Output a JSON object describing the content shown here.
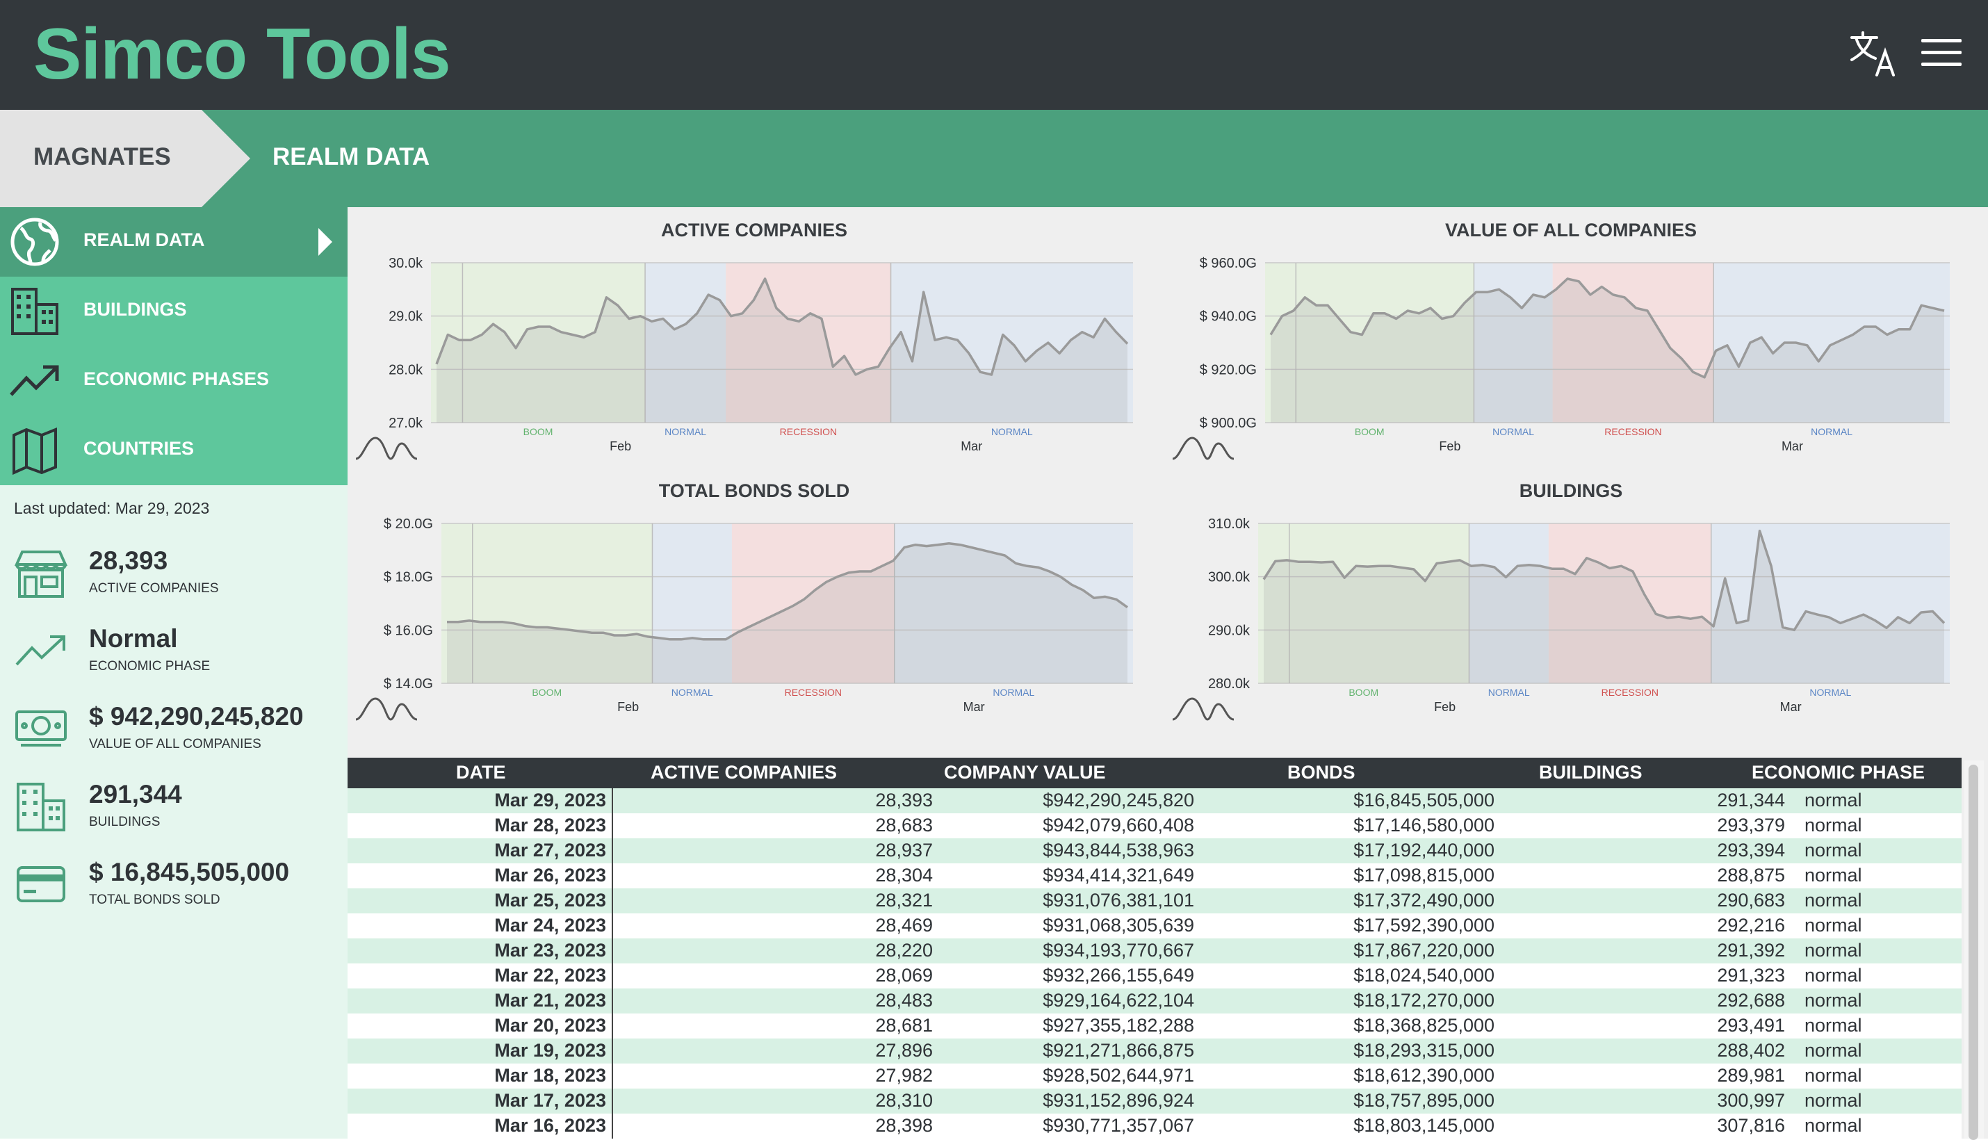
{
  "app": {
    "title": "Simco Tools"
  },
  "breadcrumb": {
    "items": [
      "MAGNATES",
      "REALM DATA"
    ]
  },
  "sidebar": {
    "items": [
      {
        "label": "REALM DATA",
        "icon": "globe-icon"
      },
      {
        "label": "BUILDINGS",
        "icon": "buildings-icon"
      },
      {
        "label": "ECONOMIC PHASES",
        "icon": "trending-up-icon"
      },
      {
        "label": "COUNTRIES",
        "icon": "map-icon"
      }
    ],
    "last_updated": "Last updated: Mar 29, 2023",
    "stats": [
      {
        "value": "28,393",
        "label": "ACTIVE COMPANIES",
        "icon": "store-icon"
      },
      {
        "value": "Normal",
        "label": "ECONOMIC PHASE",
        "icon": "trending-up-icon"
      },
      {
        "value": "$ 942,290,245,820",
        "label": "VALUE OF ALL COMPANIES",
        "icon": "money-icon"
      },
      {
        "value": "291,344",
        "label": "BUILDINGS",
        "icon": "buildings-icon"
      },
      {
        "value": "$ 16,845,505,000",
        "label": "TOTAL BONDS SOLD",
        "icon": "credit-card-icon"
      }
    ]
  },
  "colors": {
    "header": "#33383c",
    "accent": "#5ec79c",
    "accent_dark": "#4ba07d",
    "boom": "#e6f0e0",
    "normal": "#e1e8f1",
    "recession": "#f4dfdf"
  },
  "phase_labels": {
    "boom": "BOOM",
    "normal": "NORMAL",
    "recession": "RECESSION"
  },
  "chart_data": [
    {
      "type": "line",
      "title": "ACTIVE COMPANIES",
      "yticks": [
        "30.0k",
        "29.0k",
        "28.0k",
        "27.0k"
      ],
      "ylim": [
        27000,
        30000
      ],
      "xticks": [
        "Feb",
        "Mar"
      ],
      "phases": [
        "boom",
        "normal",
        "recession",
        "normal"
      ],
      "values": [
        28100,
        28650,
        28550,
        28550,
        28650,
        28850,
        28700,
        28400,
        28750,
        28800,
        28800,
        28700,
        28650,
        28600,
        28700,
        29350,
        29200,
        28950,
        29000,
        28900,
        28950,
        28750,
        28850,
        29050,
        29400,
        29300,
        29000,
        29050,
        29300,
        29700,
        29150,
        28950,
        28900,
        29050,
        28950,
        28050,
        28250,
        27900,
        28000,
        28050,
        28400,
        28700,
        28150,
        29450,
        28550,
        28600,
        28550,
        28300,
        27950,
        27900,
        28650,
        28450,
        28150,
        28350,
        28500,
        28300,
        28550,
        28700,
        28600,
        28950,
        28700,
        28480
      ]
    },
    {
      "type": "line",
      "title": "VALUE OF ALL COMPANIES",
      "yticks": [
        "$ 960.0G",
        "$ 940.0G",
        "$ 920.0G",
        "$ 900.0G"
      ],
      "ylim": [
        900,
        960
      ],
      "xticks": [
        "Feb",
        "Mar"
      ],
      "phases": [
        "boom",
        "normal",
        "recession",
        "normal"
      ],
      "values": [
        933,
        940,
        942,
        947,
        944,
        944,
        939,
        934,
        933,
        941,
        941,
        939,
        942,
        941,
        943,
        939,
        940,
        945,
        949,
        949,
        950,
        947,
        943,
        948,
        947,
        950,
        954,
        953,
        948,
        951,
        948,
        947,
        943,
        942,
        935,
        928,
        924,
        919,
        917,
        927,
        929,
        921,
        930,
        932,
        926,
        930,
        930,
        929,
        923,
        929,
        931,
        933,
        936,
        936,
        933,
        935,
        935,
        944,
        943,
        942
      ]
    },
    {
      "type": "area",
      "title": "TOTAL BONDS SOLD",
      "yticks": [
        "$ 20.0G",
        "$ 18.0G",
        "$ 16.0G",
        "$ 14.0G"
      ],
      "ylim": [
        14,
        20
      ],
      "xticks": [
        "Feb",
        "Mar"
      ],
      "phases": [
        "boom",
        "normal",
        "recession",
        "normal"
      ],
      "values": [
        16.3,
        16.3,
        16.35,
        16.3,
        16.3,
        16.3,
        16.25,
        16.15,
        16.1,
        16.1,
        16.05,
        16.0,
        15.95,
        15.9,
        15.9,
        15.8,
        15.8,
        15.85,
        15.75,
        15.7,
        15.65,
        15.65,
        15.7,
        15.65,
        15.65,
        15.65,
        15.9,
        16.1,
        16.3,
        16.5,
        16.7,
        16.9,
        17.15,
        17.5,
        17.8,
        18.0,
        18.15,
        18.2,
        18.2,
        18.4,
        18.6,
        19.1,
        19.2,
        19.15,
        19.2,
        19.25,
        19.2,
        19.1,
        19.0,
        18.9,
        18.8,
        18.5,
        18.4,
        18.35,
        18.2,
        18.0,
        17.7,
        17.5,
        17.2,
        17.25,
        17.15,
        16.85
      ]
    },
    {
      "type": "line",
      "title": "BUILDINGS",
      "yticks": [
        "310.0k",
        "300.0k",
        "290.0k",
        "280.0k"
      ],
      "ylim": [
        280000,
        310000
      ],
      "xticks": [
        "Feb",
        "Mar"
      ],
      "phases": [
        "boom",
        "normal",
        "recession",
        "normal"
      ],
      "values": [
        299500,
        302900,
        303100,
        302800,
        302800,
        302700,
        302800,
        299800,
        302000,
        301900,
        302000,
        302000,
        301700,
        301400,
        299200,
        302500,
        302800,
        303100,
        302000,
        302200,
        301800,
        299900,
        302000,
        302200,
        302000,
        301500,
        301500,
        300500,
        303500,
        302700,
        301600,
        302000,
        301000,
        296700,
        293000,
        292300,
        292500,
        292100,
        292500,
        290700,
        299700,
        291300,
        291800,
        308600,
        302000,
        290500,
        290000,
        293500,
        292900,
        292400,
        291300,
        292100,
        292900,
        291800,
        290400,
        292400,
        291300,
        293300,
        293500,
        291300
      ]
    }
  ],
  "table": {
    "headers": [
      "DATE",
      "ACTIVE COMPANIES",
      "COMPANY VALUE",
      "BONDS",
      "BUILDINGS",
      "ECONOMIC PHASE"
    ],
    "rows": [
      [
        "Mar 29, 2023",
        "28,393",
        "$942,290,245,820",
        "$16,845,505,000",
        "291,344",
        "normal"
      ],
      [
        "Mar 28, 2023",
        "28,683",
        "$942,079,660,408",
        "$17,146,580,000",
        "293,379",
        "normal"
      ],
      [
        "Mar 27, 2023",
        "28,937",
        "$943,844,538,963",
        "$17,192,440,000",
        "293,394",
        "normal"
      ],
      [
        "Mar 26, 2023",
        "28,304",
        "$934,414,321,649",
        "$17,098,815,000",
        "288,875",
        "normal"
      ],
      [
        "Mar 25, 2023",
        "28,321",
        "$931,076,381,101",
        "$17,372,490,000",
        "290,683",
        "normal"
      ],
      [
        "Mar 24, 2023",
        "28,469",
        "$931,068,305,639",
        "$17,592,390,000",
        "292,216",
        "normal"
      ],
      [
        "Mar 23, 2023",
        "28,220",
        "$934,193,770,667",
        "$17,867,220,000",
        "291,392",
        "normal"
      ],
      [
        "Mar 22, 2023",
        "28,069",
        "$932,266,155,649",
        "$18,024,540,000",
        "291,323",
        "normal"
      ],
      [
        "Mar 21, 2023",
        "28,483",
        "$929,164,622,104",
        "$18,172,270,000",
        "292,688",
        "normal"
      ],
      [
        "Mar 20, 2023",
        "28,681",
        "$927,355,182,288",
        "$18,368,825,000",
        "293,491",
        "normal"
      ],
      [
        "Mar 19, 2023",
        "27,896",
        "$921,271,866,875",
        "$18,293,315,000",
        "288,402",
        "normal"
      ],
      [
        "Mar 18, 2023",
        "27,982",
        "$928,502,644,971",
        "$18,612,390,000",
        "289,981",
        "normal"
      ],
      [
        "Mar 17, 2023",
        "28,310",
        "$931,152,896,924",
        "$18,757,895,000",
        "300,997",
        "normal"
      ],
      [
        "Mar 16, 2023",
        "28,398",
        "$930,771,357,067",
        "$18,803,145,000",
        "307,816",
        "normal"
      ]
    ]
  }
}
